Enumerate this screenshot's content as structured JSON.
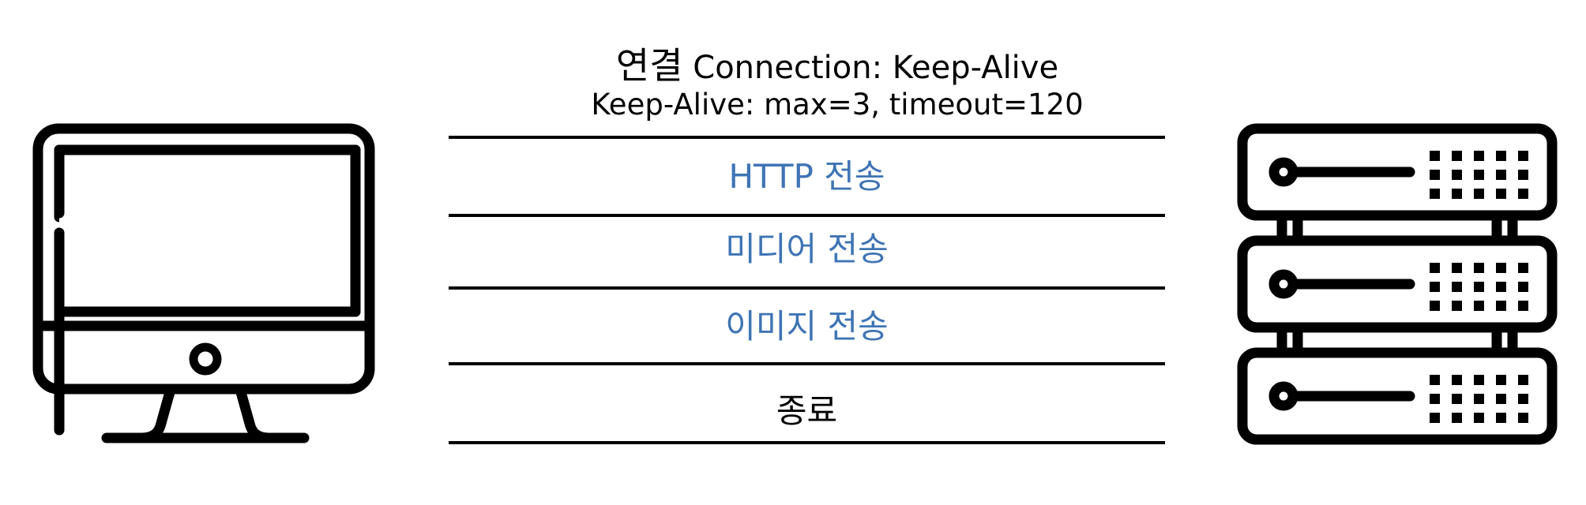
{
  "header": {
    "line1_ko": "연결",
    "line1_en": "Connection: Keep-Alive",
    "line2": "Keep-Alive: max=3, timeout=120"
  },
  "steps": [
    {
      "label": "HTTP 전송",
      "color": "#3f74b4"
    },
    {
      "label": "미디어 전송",
      "color": "#3f74b4"
    },
    {
      "label": "이미지 전송",
      "color": "#3f74b4"
    },
    {
      "label": "종료",
      "color": "#000000"
    }
  ],
  "nodes": {
    "client_icon": "desktop-computer-icon",
    "server_icon": "server-rack-icon"
  }
}
